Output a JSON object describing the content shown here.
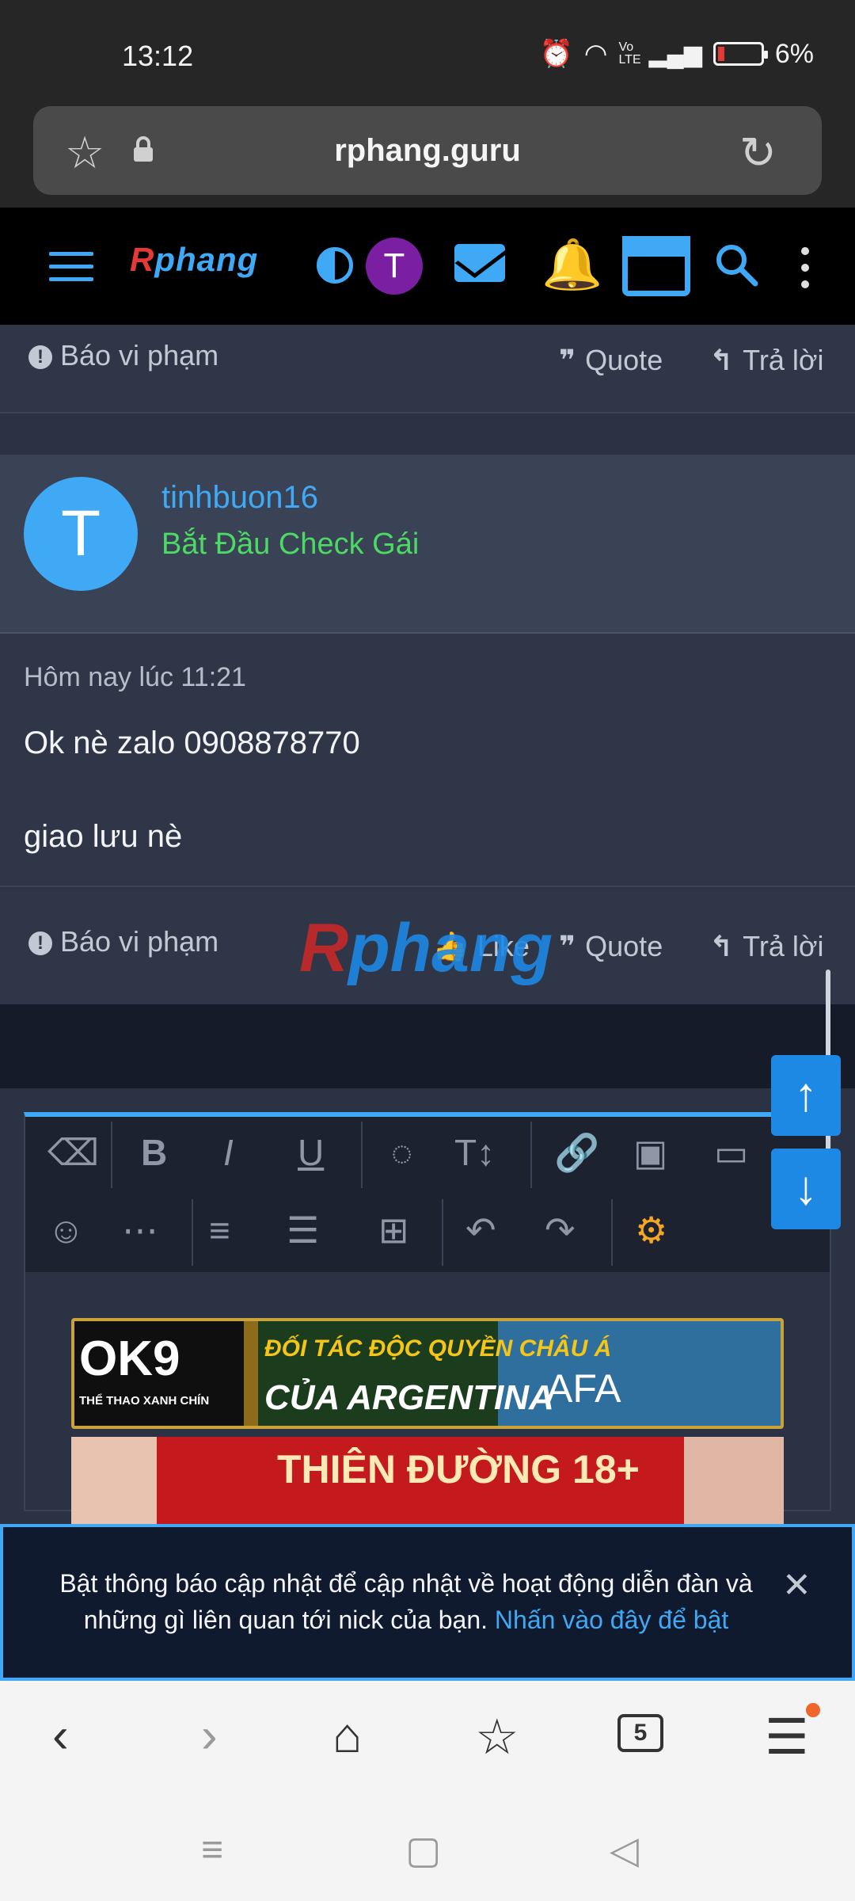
{
  "status": {
    "time": "13:12",
    "battery": "6%",
    "network_label": "Vo LTE"
  },
  "browser": {
    "url": "rphang.guru",
    "tab_count": "5"
  },
  "site": {
    "logo": {
      "first": "R",
      "rest": "phang"
    },
    "avatar_letter": "T"
  },
  "post1": {
    "report_label": "Báo vi phạm",
    "quote_label": "Quote",
    "reply_label": "Trả lời"
  },
  "post2": {
    "avatar_letter": "T",
    "username": "tinhbuon16",
    "user_title": "Bắt Đầu Check Gái",
    "date": "Hôm nay lúc 11:21",
    "lines": [
      "Ok nè zalo 0908878770",
      "giao lưu nè"
    ],
    "report_label": "Báo vi phạm",
    "like_label": "Like",
    "quote_label": "Quote",
    "reply_label": "Trả lời"
  },
  "watermark": {
    "first": "R",
    "rest": "phang"
  },
  "banners": {
    "ok9_logo": "OK9",
    "ok9_sub": "THỂ THAO XANH CHÍN",
    "partner_line": "ĐỐI TÁC ĐỘC QUYỀN CHÂU Á",
    "partner_name": "CỦA ARGENTINA",
    "afa": "AFA",
    "second": "THIÊN ĐƯỜNG 18+"
  },
  "notice": {
    "text": "Bật thông báo cập nhật để cập nhật về hoạt động diễn đàn và những gì liên quan tới nick của bạn. ",
    "link": "Nhấn vào đây để bật"
  }
}
